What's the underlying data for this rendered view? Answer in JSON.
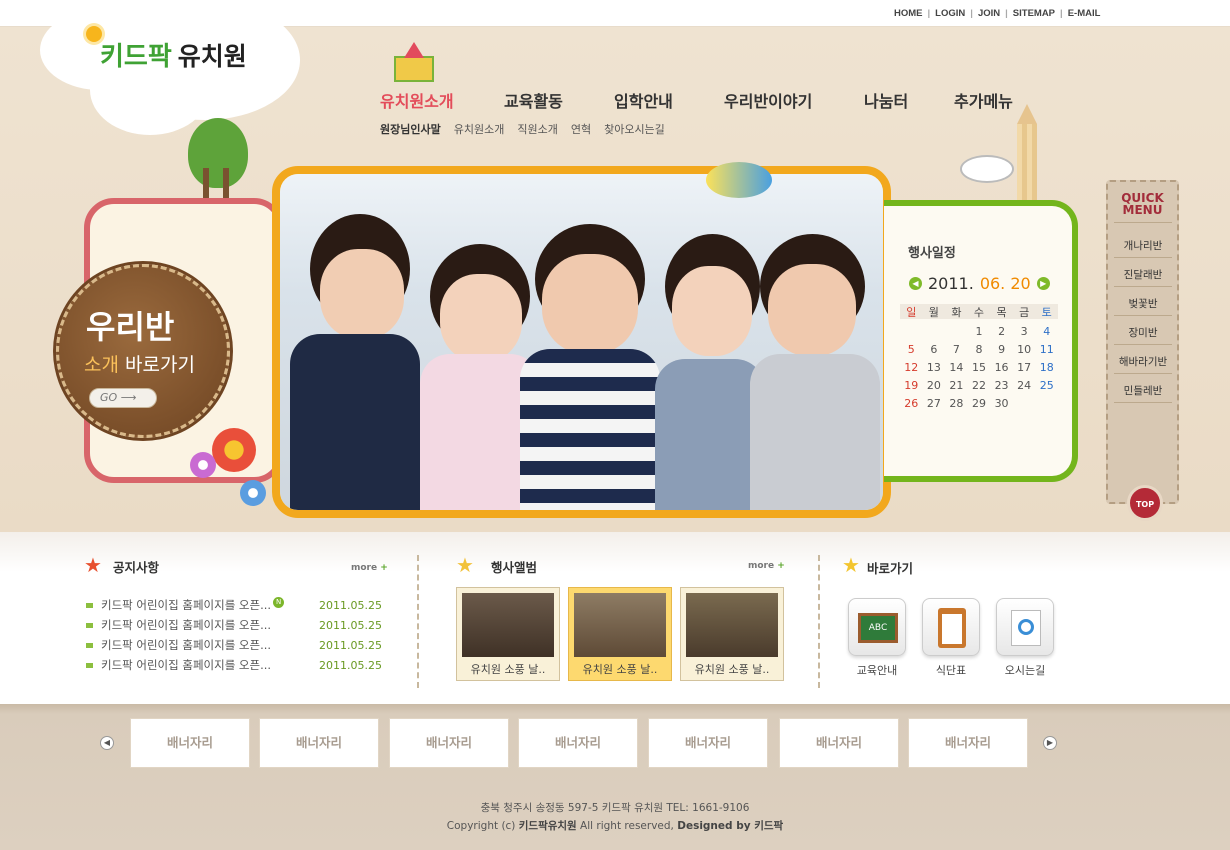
{
  "top_links": [
    "HOME",
    "LOGIN",
    "JOIN",
    "SITEMAP",
    "E-MAIL"
  ],
  "logo": {
    "kid": "키드팍",
    "school": "유치원"
  },
  "nav": [
    "유치원소개",
    "교육활동",
    "입학안내",
    "우리반이야기",
    "나눔터",
    "추가메뉴"
  ],
  "subnav": [
    "원장님인사말",
    "유치원소개",
    "직원소개",
    "연혁",
    "찾아오시는길"
  ],
  "left_badge": {
    "line1": "우리반",
    "line2a": "소개",
    "line2b": " 바로가기",
    "go": "GO"
  },
  "calendar": {
    "title": "행사일정",
    "year": "2011.",
    "monthday": "06. 20",
    "dow": [
      "일",
      "월",
      "화",
      "수",
      "목",
      "금",
      "토"
    ],
    "weeks": [
      [
        "",
        "",
        "",
        "1",
        "2",
        "3",
        "4"
      ],
      [
        "5",
        "6",
        "7",
        "8",
        "9",
        "10",
        "11"
      ],
      [
        "12",
        "13",
        "14",
        "15",
        "16",
        "17",
        "18"
      ],
      [
        "19",
        "20",
        "21",
        "22",
        "23",
        "24",
        "25"
      ],
      [
        "26",
        "27",
        "28",
        "29",
        "30",
        "",
        ""
      ]
    ]
  },
  "quick": {
    "title1": "QUICK",
    "title2": "MENU",
    "items": [
      "개나리반",
      "진달래반",
      "벚꽃반",
      "장미반",
      "해바라기반",
      "민들레반"
    ],
    "top": "TOP"
  },
  "notice": {
    "title": "공지사항",
    "more": "more",
    "items": [
      {
        "text": "키드팍 어린이집 홈페이지를 오픈...",
        "date": "2011.05.25",
        "new": true
      },
      {
        "text": "키드팍 어린이집 홈페이지를 오픈...",
        "date": "2011.05.25",
        "new": false
      },
      {
        "text": "키드팍 어린이집 홈페이지를 오픈...",
        "date": "2011.05.25",
        "new": false
      },
      {
        "text": "키드팍 어린이집 홈페이지를 오픈...",
        "date": "2011.05.25",
        "new": false
      }
    ],
    "new_mark": "N"
  },
  "album": {
    "title": "행사앨범",
    "more": "more",
    "items": [
      "유치원 소풍 날..",
      "유치원 소풍 날..",
      "유치원 소풍 날.."
    ]
  },
  "shortcuts": {
    "title": "바로가기",
    "items": [
      "교육안내",
      "식단표",
      "오시는길"
    ]
  },
  "banners": [
    "배너자리",
    "배너자리",
    "배너자리",
    "배너자리",
    "배너자리",
    "배너자리",
    "배너자리"
  ],
  "footer": {
    "address": "충북 청주시 송정동 597-5 키드팍 유치원   TEL: 1661-9106",
    "copy_prefix": "Copyright (c) ",
    "copy_name": "키드팍유치원",
    "copy_mid": " All right reserved, ",
    "copy_designed": "Designed by 키드팍"
  }
}
